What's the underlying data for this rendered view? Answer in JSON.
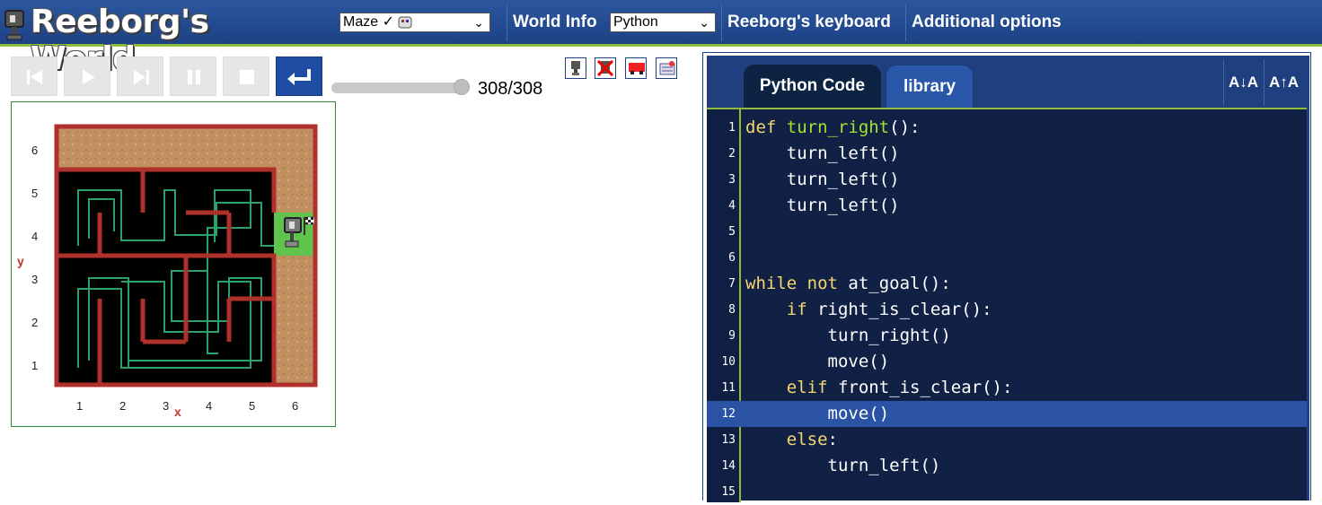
{
  "header": {
    "title": "Reeborg's World",
    "world_select": "Maze ✓",
    "world_info": "World Info",
    "language_select": "Python",
    "keyboard": "Reeborg's keyboard",
    "additional": "Additional options"
  },
  "controls": {
    "step_counter": "308/308",
    "progress": 1.0
  },
  "world": {
    "y_label": "y",
    "x_label": "x",
    "rows": [
      "6",
      "5",
      "4",
      "3",
      "2",
      "1"
    ],
    "cols": [
      "1",
      "2",
      "3",
      "4",
      "5",
      "6"
    ]
  },
  "editor": {
    "tabs": [
      "Python Code",
      "library"
    ],
    "font_smaller": "A↓A",
    "font_larger": "A↑A",
    "active_line": 12,
    "lines": [
      {
        "n": "1",
        "tokens": [
          [
            "kw",
            "def "
          ],
          [
            "fn",
            "turn_right"
          ],
          [
            "t",
            "():"
          ]
        ]
      },
      {
        "n": "2",
        "tokens": [
          [
            "t",
            "    turn_left()"
          ]
        ]
      },
      {
        "n": "3",
        "tokens": [
          [
            "t",
            "    turn_left()"
          ]
        ]
      },
      {
        "n": "4",
        "tokens": [
          [
            "t",
            "    turn_left()"
          ]
        ]
      },
      {
        "n": "5",
        "tokens": []
      },
      {
        "n": "6",
        "tokens": []
      },
      {
        "n": "7",
        "tokens": [
          [
            "kw",
            "while not "
          ],
          [
            "t",
            "at_goal():"
          ]
        ]
      },
      {
        "n": "8",
        "tokens": [
          [
            "t",
            "    "
          ],
          [
            "kw",
            "if "
          ],
          [
            "t",
            "right_is_clear():"
          ]
        ]
      },
      {
        "n": "9",
        "tokens": [
          [
            "t",
            "        turn_right()"
          ]
        ]
      },
      {
        "n": "10",
        "tokens": [
          [
            "t",
            "        move()"
          ]
        ]
      },
      {
        "n": "11",
        "tokens": [
          [
            "t",
            "    "
          ],
          [
            "kw",
            "elif "
          ],
          [
            "t",
            "front_is_clear():"
          ]
        ]
      },
      {
        "n": "12",
        "tokens": [
          [
            "t",
            "        move()"
          ]
        ]
      },
      {
        "n": "13",
        "tokens": [
          [
            "t",
            "    "
          ],
          [
            "kw",
            "else"
          ],
          [
            "t",
            ":"
          ]
        ]
      },
      {
        "n": "14",
        "tokens": [
          [
            "t",
            "        turn_left()"
          ]
        ]
      },
      {
        "n": "15",
        "tokens": []
      }
    ]
  }
}
